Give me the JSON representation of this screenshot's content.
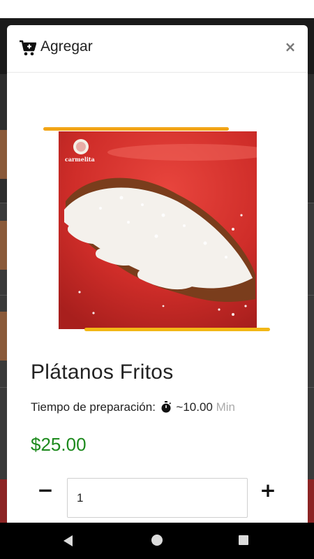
{
  "modal": {
    "title": "Agregar",
    "close_symbol": "×",
    "header_icon": "cart-plus-icon"
  },
  "product": {
    "name": "Plátanos Fritos",
    "prep_label": "Tiempo de preparación:",
    "prep_icon": "stopwatch-icon",
    "prep_value": "~10.00",
    "prep_unit": "Min",
    "price": "$25.00",
    "image_logo_text": "carmelita"
  },
  "quantity": {
    "minus_symbol": "−",
    "value": "1",
    "plus_symbol": "+"
  },
  "colors": {
    "price": "#1d8a1d",
    "accent": "#f2a516",
    "plate": "#d2322f"
  }
}
